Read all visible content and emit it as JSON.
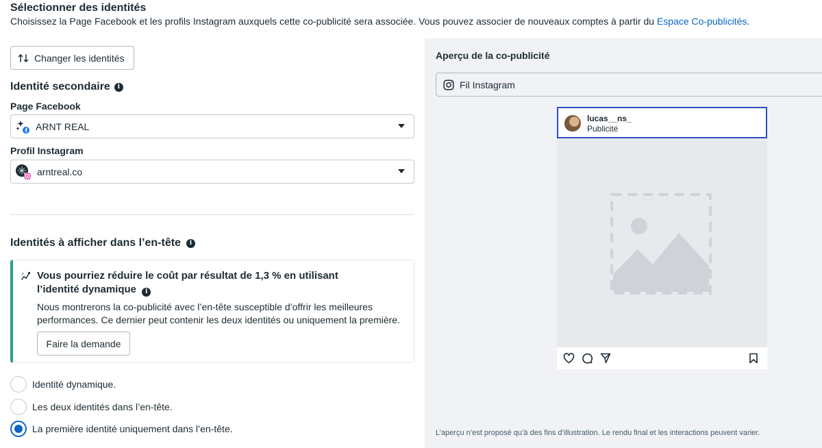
{
  "header": {
    "title": "Sélectionner des identités",
    "description": "Choisissez la Page Facebook et les profils Instagram auxquels cette co-publicité sera associée. Vous pouvez associer de nouveaux comptes à partir du ",
    "link": "Espace Co-publicités",
    "suffix": "."
  },
  "change_button": {
    "label": "Changer les identités",
    "icon": "swap-arrows-icon"
  },
  "secondary": {
    "title": "Identité secondaire",
    "facebook_label": "Page Facebook",
    "facebook_value": "ARNT REAL",
    "instagram_label": "Profil Instagram",
    "instagram_value": "arntreal.co"
  },
  "header_identities": {
    "title": "Identités à afficher dans l’en-tête",
    "callout": {
      "icon": "trend-chart-icon",
      "title": "Vous pourriez réduire le coût par résultat de 1,3 % en utilisant l’identité dynamique",
      "body": "Nous montrerons la co-publicité avec l’en-tête susceptible d’offrir les meilleures performances. Ce dernier peut contenir les deux identités ou uniquement la première.",
      "button": "Faire la demande"
    },
    "options": [
      {
        "label": "Identité dynamique.",
        "selected": false
      },
      {
        "label": "Les deux identités dans l’en-tête.",
        "selected": false
      },
      {
        "label": "La première identité uniquement dans l’en-tête.",
        "selected": true
      }
    ]
  },
  "preview": {
    "title": "Aperçu de la co-publicité",
    "placement": "Fil Instagram",
    "post": {
      "username": "lucas__ns_",
      "sponsored": "Publicité"
    },
    "note": "L’aperçu n’est proposé qu’à des fins d’illustration. Le rendu final et les interactions peuvent varier."
  },
  "colors": {
    "link": "#0a66c2",
    "accent_bar": "#2e9e8f",
    "preview_bg": "#f0f2f5",
    "focus_border": "#2d4fbd"
  }
}
